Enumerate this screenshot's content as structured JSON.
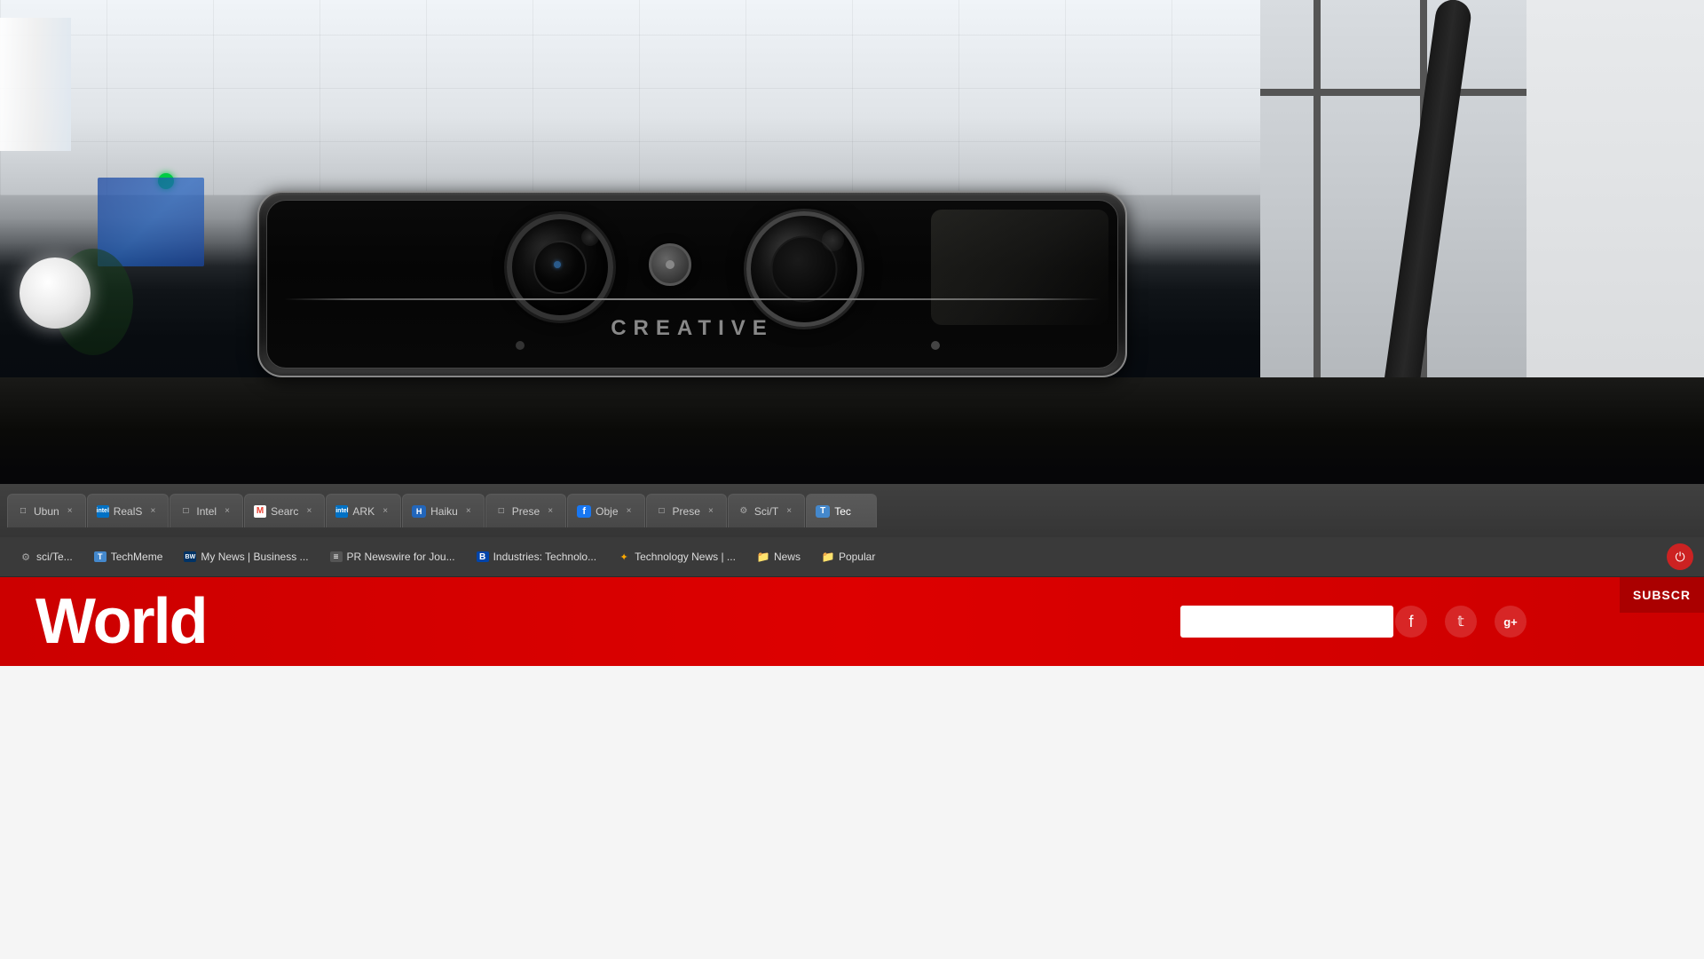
{
  "photo": {
    "webcam_brand": "CREATIVE",
    "alt": "Creative webcam mounted on top of a monitor in an office setting"
  },
  "browser": {
    "tabs": [
      {
        "id": "ubuntu",
        "icon_type": "file",
        "icon_char": "□",
        "title": "Ubun",
        "active": false
      },
      {
        "id": "realsense",
        "icon_type": "intel",
        "icon_char": "intel",
        "title": "RealS",
        "active": false
      },
      {
        "id": "intel2",
        "icon_type": "file",
        "icon_char": "□",
        "title": "Intel",
        "active": false
      },
      {
        "id": "gmail",
        "icon_type": "gmail",
        "icon_char": "M",
        "title": "Searc",
        "active": false
      },
      {
        "id": "ark",
        "icon_type": "intel",
        "icon_char": "intel",
        "title": "ARK",
        "active": false
      },
      {
        "id": "haiku",
        "icon_type": "haiku",
        "icon_char": "H",
        "title": "Haiku",
        "active": false
      },
      {
        "id": "prese1",
        "icon_type": "file",
        "icon_char": "□",
        "title": "Prese",
        "active": false
      },
      {
        "id": "object",
        "icon_type": "fb",
        "icon_char": "f",
        "title": "Obje",
        "active": false
      },
      {
        "id": "prese2",
        "icon_type": "file",
        "icon_char": "□",
        "title": "Prese",
        "active": false
      },
      {
        "id": "scitec",
        "icon_type": "file",
        "icon_char": "□",
        "title": "Sci/T",
        "active": false
      },
      {
        "id": "techmeme_tab",
        "icon_type": "techmeme",
        "icon_char": "T",
        "title": "Tec",
        "active": false
      }
    ],
    "close_label": "×"
  },
  "bookmarks": {
    "items": [
      {
        "id": "sci_te",
        "icon_type": "file",
        "icon_char": "□",
        "label": "sci/Te..."
      },
      {
        "id": "techmeme",
        "icon_type": "techmeme",
        "icon_char": "T",
        "label": "TechMeme"
      },
      {
        "id": "mynews",
        "icon_type": "bw",
        "icon_char": "BW",
        "label": "My News | Business ..."
      },
      {
        "id": "prnewswire",
        "icon_type": "pr",
        "icon_char": "≡",
        "label": "PR Newswire for Jou..."
      },
      {
        "id": "bloomberg",
        "icon_type": "bb",
        "icon_char": "B",
        "label": "Industries: Technolo..."
      },
      {
        "id": "technews",
        "icon_type": "sun",
        "icon_char": "✦",
        "label": "Technology News | ..."
      },
      {
        "id": "news_folder",
        "icon_type": "folder",
        "icon_char": "📁",
        "label": "News"
      },
      {
        "id": "popular_folder",
        "icon_type": "folder",
        "icon_char": "📁",
        "label": "Popular"
      }
    ],
    "power_button": "⏻"
  },
  "website": {
    "title": "World",
    "subscribe_label": "SUBSCR",
    "social": {
      "facebook": "f",
      "twitter": "t",
      "googleplus": "g+"
    }
  }
}
